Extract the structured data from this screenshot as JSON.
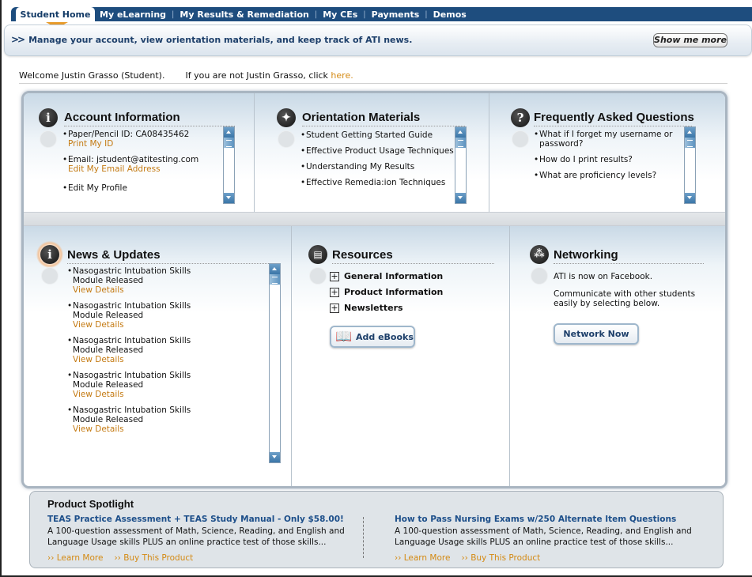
{
  "nav": {
    "active_tab": "Student Home",
    "tabs": [
      "My eLearning",
      "My Results & Remediation",
      "My CEs",
      "Payments",
      "Demos"
    ],
    "separator": "|"
  },
  "subbar": {
    "chevrons": ">>",
    "text": "Manage your account, view orientation materials, and keep track of ATI news.",
    "show_more": "Show me more"
  },
  "welcome": {
    "text": "Welcome Justin Grasso (Student).",
    "not_user": "If you are not Justin Grasso, click",
    "link": "here."
  },
  "account": {
    "title": "Account Information",
    "icon": "info-icon",
    "items": [
      {
        "text": "Paper/Pencil ID: CA08435462",
        "link": "Print My ID"
      },
      {
        "text": "Email: jstudent@atitesting.com",
        "link": "Edit My Email Address"
      },
      {
        "text": "Edit My Profile",
        "link": ""
      }
    ]
  },
  "orientation": {
    "title": "Orientation Materials",
    "icon": "compass-icon",
    "items": [
      "Student Getting Started Guide",
      "Effective Product Usage Techniques",
      "Understanding My Results",
      "Effective Remedia:ion Techniques"
    ]
  },
  "faq": {
    "title": "Frequently Asked Questions",
    "icon": "question-icon",
    "items": [
      "What if I forget my username or password?",
      "How do I print results?",
      "What are proficiency levels?"
    ]
  },
  "news": {
    "title": "News & Updates",
    "icon": "info-icon",
    "items": [
      {
        "text": "Nasogastric Intubation Skills Module Released",
        "link": "View Details"
      },
      {
        "text": "Nasogastric Intubation Skills Module Released",
        "link": "View Details"
      },
      {
        "text": "Nasogastric Intubation Skills Module Released",
        "link": "View Details"
      },
      {
        "text": "Nasogastric Intubation Skills Module Released",
        "link": "View Details"
      },
      {
        "text": "Nasogastric Intubation Skills Module Released",
        "link": "View Details"
      }
    ]
  },
  "resources": {
    "title": "Resources",
    "icon": "document-icon",
    "items": [
      "General Information",
      "Product Information",
      "Newsletters"
    ],
    "ebooks_button": "Add eBooks"
  },
  "networking": {
    "title": "Networking",
    "icon": "network-icon",
    "facebook": "ATI is now on Facebook.",
    "communicate": "Communicate with other students easily by selecting below.",
    "button": "Network Now"
  },
  "spotlight": {
    "title": "Product Spotlight",
    "products": [
      {
        "title": "TEAS Practice Assessment + TEAS Study Manual - Only $58.00!",
        "desc": "A 100-question assessment of Math, Science, Reading, and English and Language Usage skills PLUS an online practice test of those skills...",
        "learn": "›› Learn More",
        "buy": "›› Buy This Product"
      },
      {
        "title": "How to Pass Nursing Exams w/250 Alternate Item Questions",
        "desc": "A 100-question assessment of Math, Science, Reading, and English and Language Usage skills PLUS an online practice test of those skills...",
        "learn": "›› Learn More",
        "buy": "›› Buy This Product"
      }
    ]
  },
  "colors": {
    "nav_blue": "#1e4d7e",
    "link_orange": "#d48a13",
    "title_blue": "#1d4f8a"
  }
}
